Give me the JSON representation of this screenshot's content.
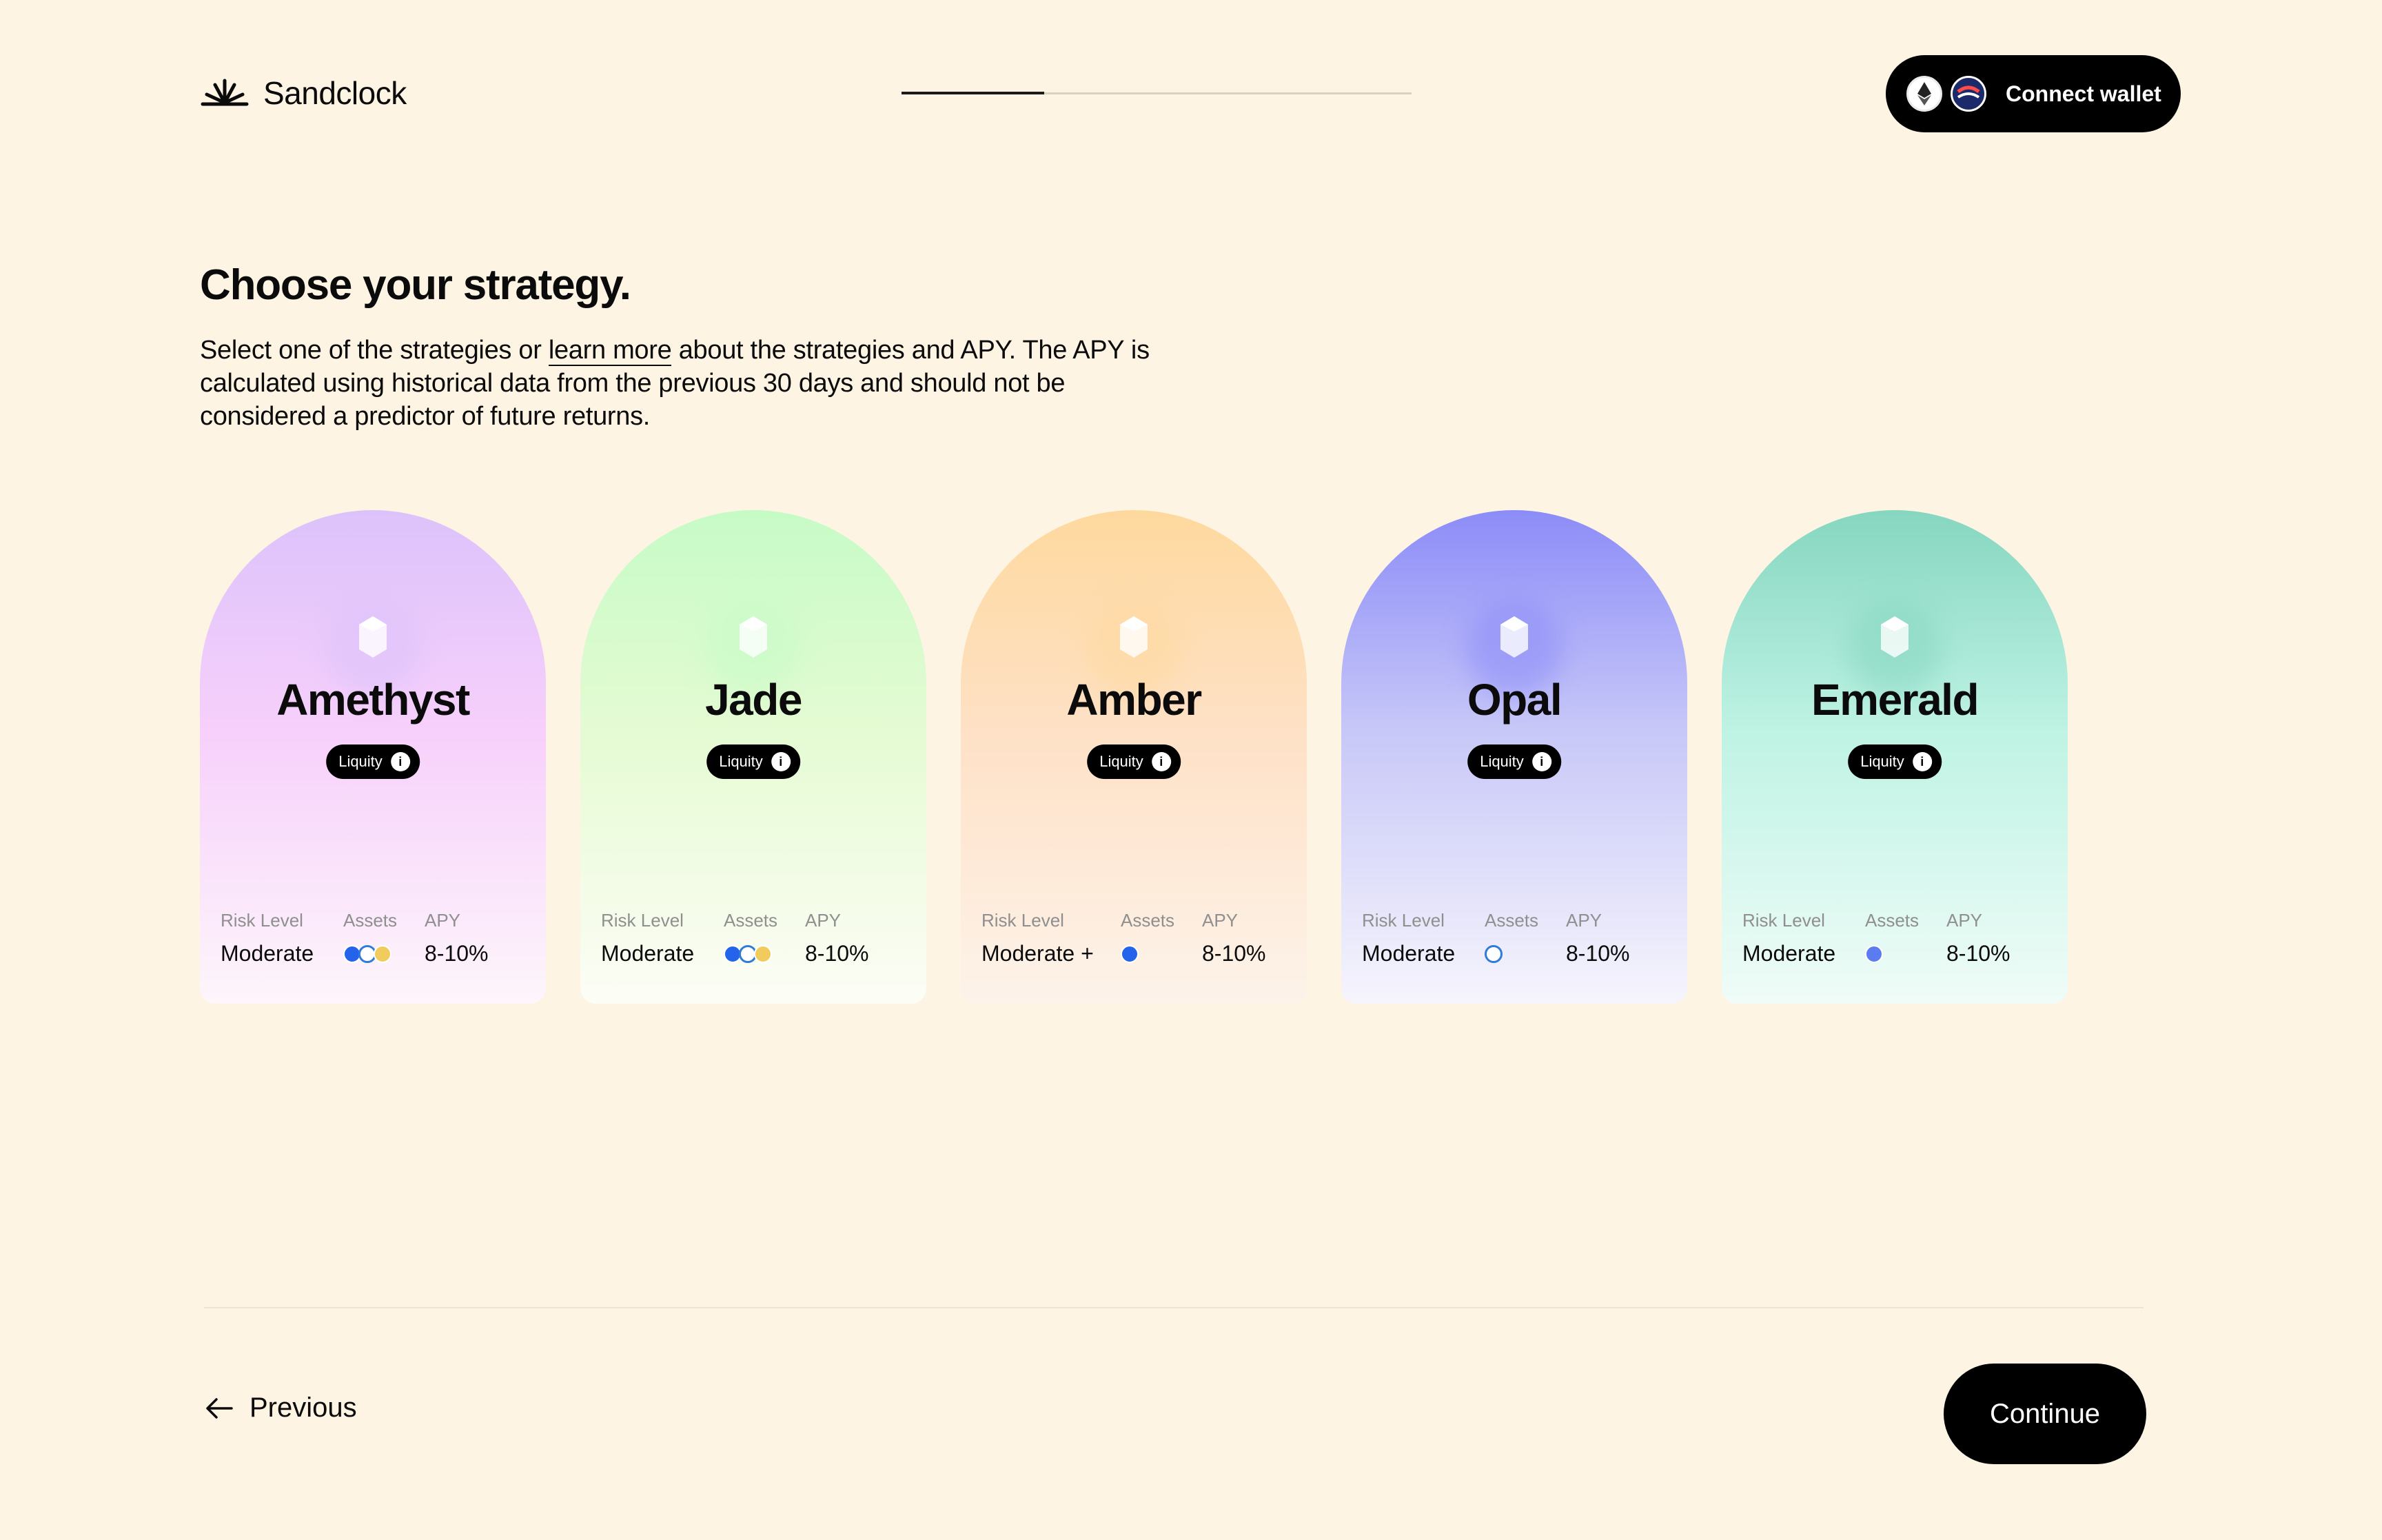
{
  "header": {
    "brand": "Sandclock",
    "logo_icon": "sandclock-logo-icon",
    "progress_fraction": 0.28,
    "wallet": {
      "label": "Connect wallet",
      "chain_icons": [
        "ethereum-icon",
        "optimism-icon"
      ]
    }
  },
  "intro": {
    "title": "Choose your strategy.",
    "desc_before": "Select one of the strategies or ",
    "desc_link": "learn more",
    "desc_after": " about the strategies and APY. The APY is calculated using historical data from the previous 30 days and should not be considered a predictor of future returns."
  },
  "labels": {
    "risk": "Risk Level",
    "assets": "Assets",
    "apy": "APY"
  },
  "cards": [
    {
      "name": "Amethyst",
      "protocol": "Liquity",
      "risk": "Moderate",
      "apy": "8-10%",
      "assets": [
        "lusd-icon",
        "usdc-icon",
        "dai-icon"
      ],
      "colors": [
        "#dcc2fb",
        "#f7d0fb",
        "#fdf6fb"
      ]
    },
    {
      "name": "Jade",
      "protocol": "Liquity",
      "risk": "Moderate",
      "apy": "8-10%",
      "assets": [
        "lusd-icon",
        "usdc-icon",
        "dai-icon"
      ],
      "colors": [
        "#c6fbc6",
        "#e5fbd3",
        "#fdfdf6"
      ]
    },
    {
      "name": "Amber",
      "protocol": "Liquity",
      "risk": "Moderate +",
      "apy": "8-10%",
      "assets": [
        "lusd-icon"
      ],
      "colors": [
        "#fed99e",
        "#fee1c6",
        "#fdf3ea"
      ]
    },
    {
      "name": "Opal",
      "protocol": "Liquity",
      "risk": "Moderate",
      "apy": "8-10%",
      "assets": [
        "usdc-icon"
      ],
      "colors": [
        "#8c8cf8",
        "#c8c8f8",
        "#f6f5fc"
      ]
    },
    {
      "name": "Emerald",
      "protocol": "Liquity",
      "risk": "Moderate",
      "apy": "8-10%",
      "assets": [
        "eth-icon"
      ],
      "colors": [
        "#86d6c0",
        "#bff3e4",
        "#f0fcf8"
      ]
    }
  ],
  "footer": {
    "previous_label": "Previous",
    "continue_label": "Continue"
  }
}
